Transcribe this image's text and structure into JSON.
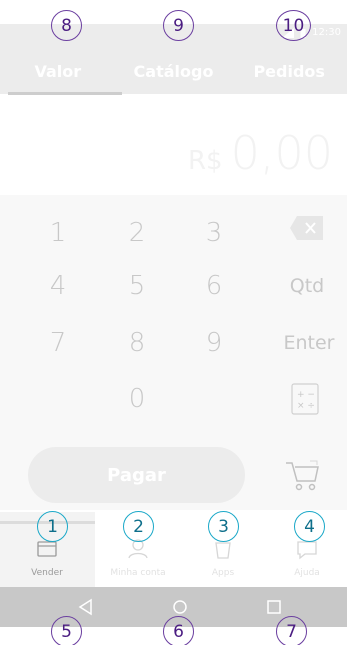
{
  "status_bar": {
    "time": "12:30"
  },
  "tabs": [
    {
      "label": "Valor",
      "active": true
    },
    {
      "label": "Catálogo",
      "active": false
    },
    {
      "label": "Pedidos",
      "active": false
    }
  ],
  "amount": {
    "currency": "R$",
    "value": "0,00"
  },
  "keypad": {
    "digits": [
      "1",
      "2",
      "3",
      "4",
      "5",
      "6",
      "7",
      "8",
      "9",
      "0"
    ],
    "qty_label": "Qtd",
    "enter_label": "Enter",
    "calc_glyph": "+ −\n× ÷"
  },
  "pay_button": {
    "label": "Pagar"
  },
  "bottom_nav": [
    {
      "label": "Vender",
      "icon": "card-icon",
      "active": true
    },
    {
      "label": "Minha conta",
      "icon": "user-icon",
      "active": false
    },
    {
      "label": "Apps",
      "icon": "bag-icon",
      "active": false
    },
    {
      "label": "Ajuda",
      "icon": "chat-icon",
      "active": false
    }
  ],
  "annotations": [
    "1",
    "2",
    "3",
    "4",
    "5",
    "6",
    "7",
    "8",
    "9",
    "10"
  ],
  "colors": {
    "annotation_purple": "#6b3fa0",
    "annotation_blue": "#1aa8c8",
    "header_bg": "#ececec",
    "nav_bar_bg": "#c8c8c8"
  }
}
